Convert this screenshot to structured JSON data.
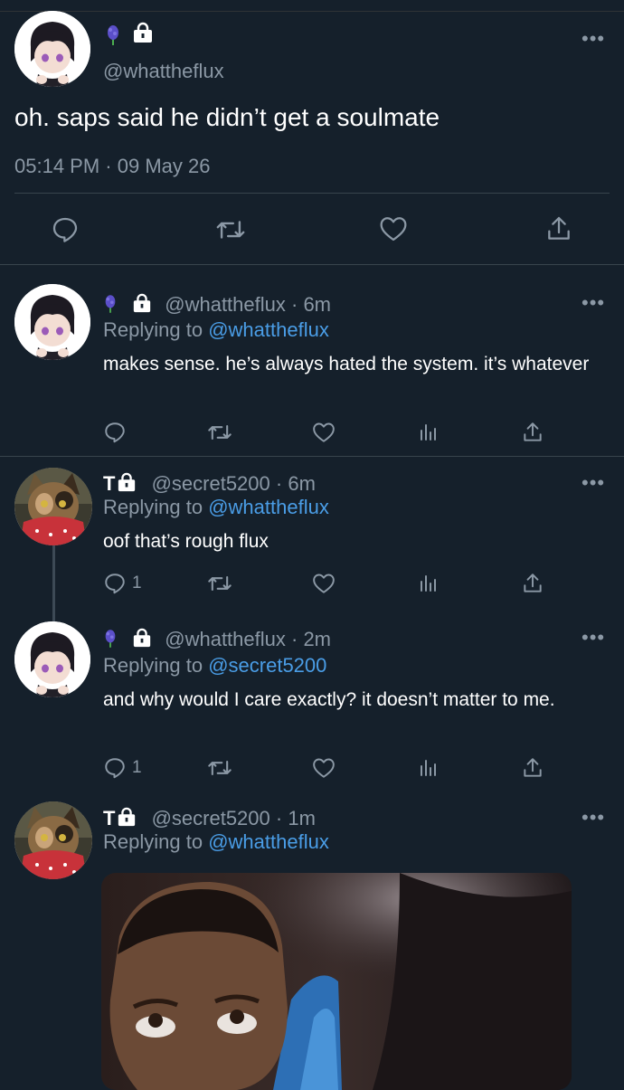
{
  "main_tweet": {
    "handle": "@whattheflux",
    "text": "oh. saps said he didn’t get a soulmate",
    "time": "05:14 PM",
    "date": "09 May 26",
    "time_sep": "·"
  },
  "replies": [
    {
      "handle": "@whattheflux",
      "age": "· 6m",
      "replying_label": "Replying to",
      "replying_to": "@whattheflux",
      "text": "makes sense. he’s always hated the system. it’s whatever",
      "reply_count": ""
    },
    {
      "name": "T",
      "handle": "@secret5200",
      "age": "· 6m",
      "replying_label": "Replying to",
      "replying_to": "@whattheflux",
      "text": "oof that’s rough flux",
      "reply_count": "1"
    },
    {
      "handle": "@whattheflux",
      "age": "· 2m",
      "replying_label": "Replying to",
      "replying_to": "@secret5200",
      "text": "and why would I care exactly? it doesn’t matter to me.",
      "reply_count": "1"
    },
    {
      "name": "T",
      "handle": "@secret5200",
      "age": "· 1m",
      "replying_label": "Replying to",
      "replying_to": "@whattheflux"
    }
  ],
  "more_label": "•••",
  "icons": {
    "reply": "reply-icon",
    "retweet": "retweet-icon",
    "like": "heart-icon",
    "analytics": "analytics-icon",
    "share": "share-icon",
    "lock": "lock-icon",
    "hyacinth": "hyacinth-emoji-icon"
  },
  "colors": {
    "background": "#15202b",
    "link": "#4a9de6",
    "muted": "#8b98a5"
  }
}
